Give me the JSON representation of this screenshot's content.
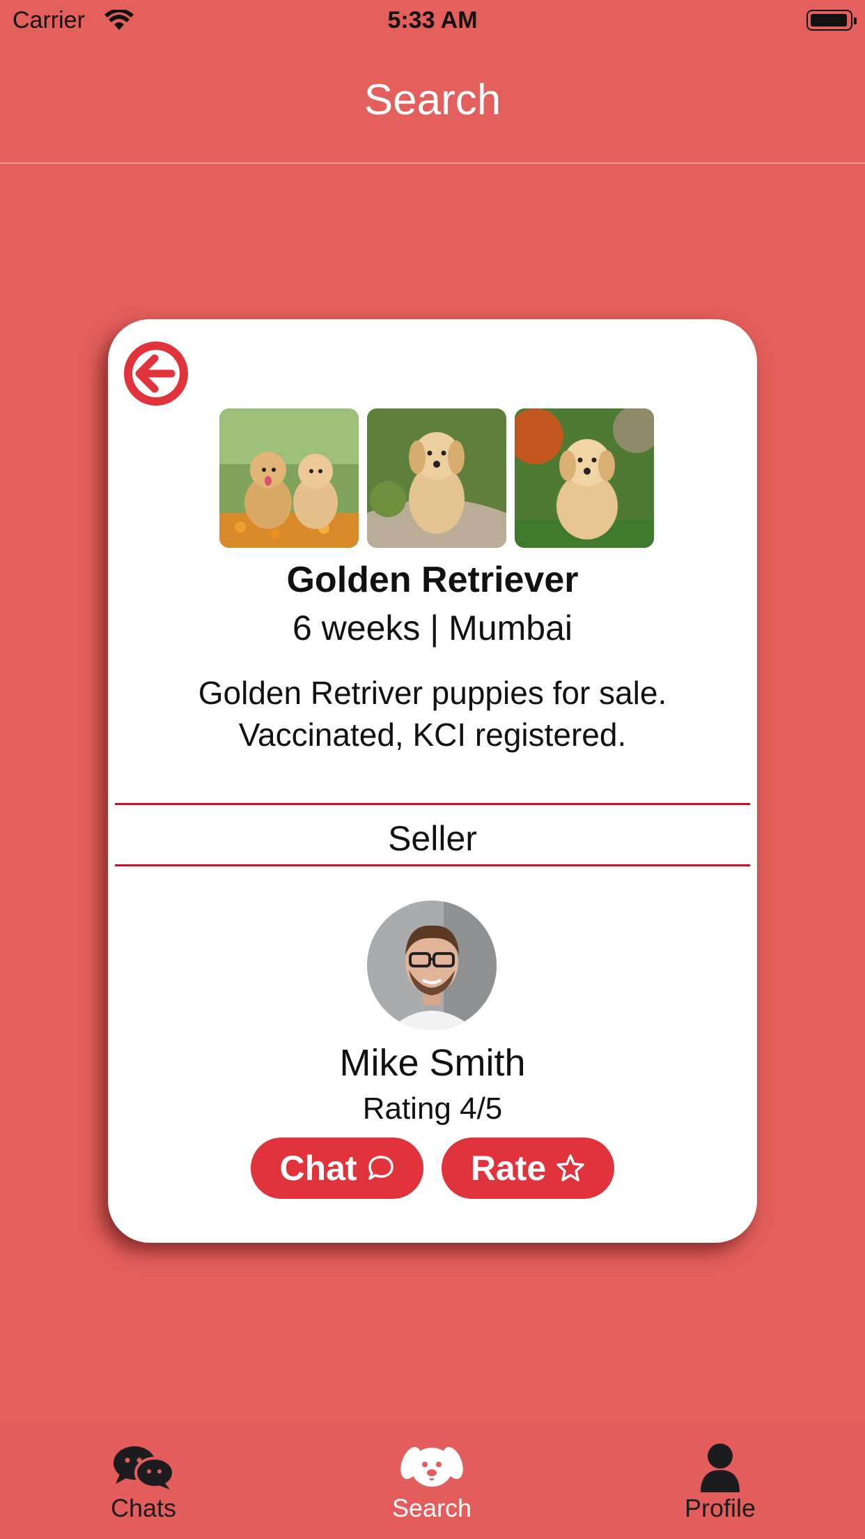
{
  "status_bar": {
    "carrier": "Carrier",
    "time": "5:33 AM"
  },
  "nav": {
    "title": "Search"
  },
  "listing": {
    "breed": "Golden Retriever",
    "age_location": "6 weeks | Mumbai",
    "description": "Golden Retriver puppies for sale. Vaccinated, KCI registered.",
    "photo_count": 3
  },
  "seller": {
    "heading": "Seller",
    "name": "Mike Smith",
    "rating": "Rating 4/5"
  },
  "actions": {
    "chat_label": "Chat",
    "rate_label": "Rate"
  },
  "tabs": [
    {
      "label": "Chats",
      "icon": "chat-bubbles-icon",
      "active": false
    },
    {
      "label": "Search",
      "icon": "dog-face-icon",
      "active": true
    },
    {
      "label": "Profile",
      "icon": "person-icon",
      "active": false
    }
  ],
  "colors": {
    "background": "#e35f5c",
    "accent": "#e0333b",
    "divider": "#c8102e",
    "card": "#ffffff"
  }
}
